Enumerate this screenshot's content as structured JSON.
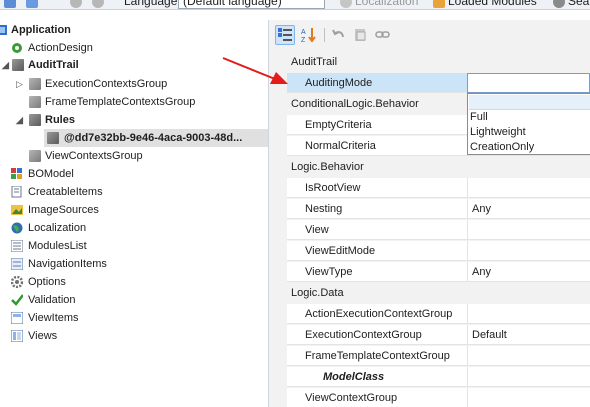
{
  "toolbar": {
    "language_label": "Language",
    "language_value": "(Default language)",
    "localization_label": "Localization",
    "loaded_modules_label": "Loaded Modules",
    "search_label": "Sea"
  },
  "tree": {
    "items": [
      {
        "label": "Application",
        "icon": "application-icon"
      },
      {
        "label": "ActionDesign",
        "icon": "action-design-icon"
      },
      {
        "label": "AuditTrail",
        "icon": "cube-icon"
      },
      {
        "label": "ExecutionContextsGroup",
        "icon": "cube-icon"
      },
      {
        "label": "FrameTemplateContextsGroup",
        "icon": "cube-icon"
      },
      {
        "label": "Rules",
        "icon": "cube-icon"
      },
      {
        "label": "@dd7e32bb-9e46-4aca-9003-48d...",
        "icon": "cube-icon"
      },
      {
        "label": "ViewContextsGroup",
        "icon": "cube-icon"
      },
      {
        "label": "BOModel",
        "icon": "bomodel-icon"
      },
      {
        "label": "CreatableItems",
        "icon": "creatable-items-icon"
      },
      {
        "label": "ImageSources",
        "icon": "image-sources-icon"
      },
      {
        "label": "Localization",
        "icon": "globe-icon"
      },
      {
        "label": "ModulesList",
        "icon": "modules-list-icon"
      },
      {
        "label": "NavigationItems",
        "icon": "navigation-items-icon"
      },
      {
        "label": "Options",
        "icon": "gear-icon"
      },
      {
        "label": "Validation",
        "icon": "checkmark-icon"
      },
      {
        "label": "ViewItems",
        "icon": "view-items-icon"
      },
      {
        "label": "Views",
        "icon": "views-icon"
      }
    ]
  },
  "grid": {
    "rows": [
      {
        "kind": "category",
        "label": "AuditTrail"
      },
      {
        "kind": "property",
        "name": "AuditingMode",
        "value": ""
      },
      {
        "kind": "category",
        "label": "ConditionalLogic.Behavior"
      },
      {
        "kind": "property",
        "name": "EmptyCriteria",
        "value": ""
      },
      {
        "kind": "property",
        "name": "NormalCriteria",
        "value": ""
      },
      {
        "kind": "category",
        "label": "Logic.Behavior"
      },
      {
        "kind": "property",
        "name": "IsRootView",
        "value": ""
      },
      {
        "kind": "property",
        "name": "Nesting",
        "value": "Any"
      },
      {
        "kind": "property",
        "name": "View",
        "value": ""
      },
      {
        "kind": "property",
        "name": "ViewEditMode",
        "value": ""
      },
      {
        "kind": "property",
        "name": "ViewType",
        "value": "Any"
      },
      {
        "kind": "category",
        "label": "Logic.Data"
      },
      {
        "kind": "property",
        "name": "ActionExecutionContextGroup",
        "value": ""
      },
      {
        "kind": "property",
        "name": "ExecutionContextGroup",
        "value": "Default"
      },
      {
        "kind": "property",
        "name": "FrameTemplateContextGroup",
        "value": ""
      },
      {
        "kind": "property",
        "name": "ModelClass",
        "value": ""
      },
      {
        "kind": "property",
        "name": "ViewContextGroup",
        "value": ""
      }
    ],
    "dropdown_options": [
      "Full",
      "Lightweight",
      "CreationOnly"
    ]
  },
  "colors": {
    "accent": "#3f7fd0",
    "annotation_arrow": "#e21b1b",
    "required_asterisk": "#c0282d",
    "selection": "#cce4f7"
  }
}
